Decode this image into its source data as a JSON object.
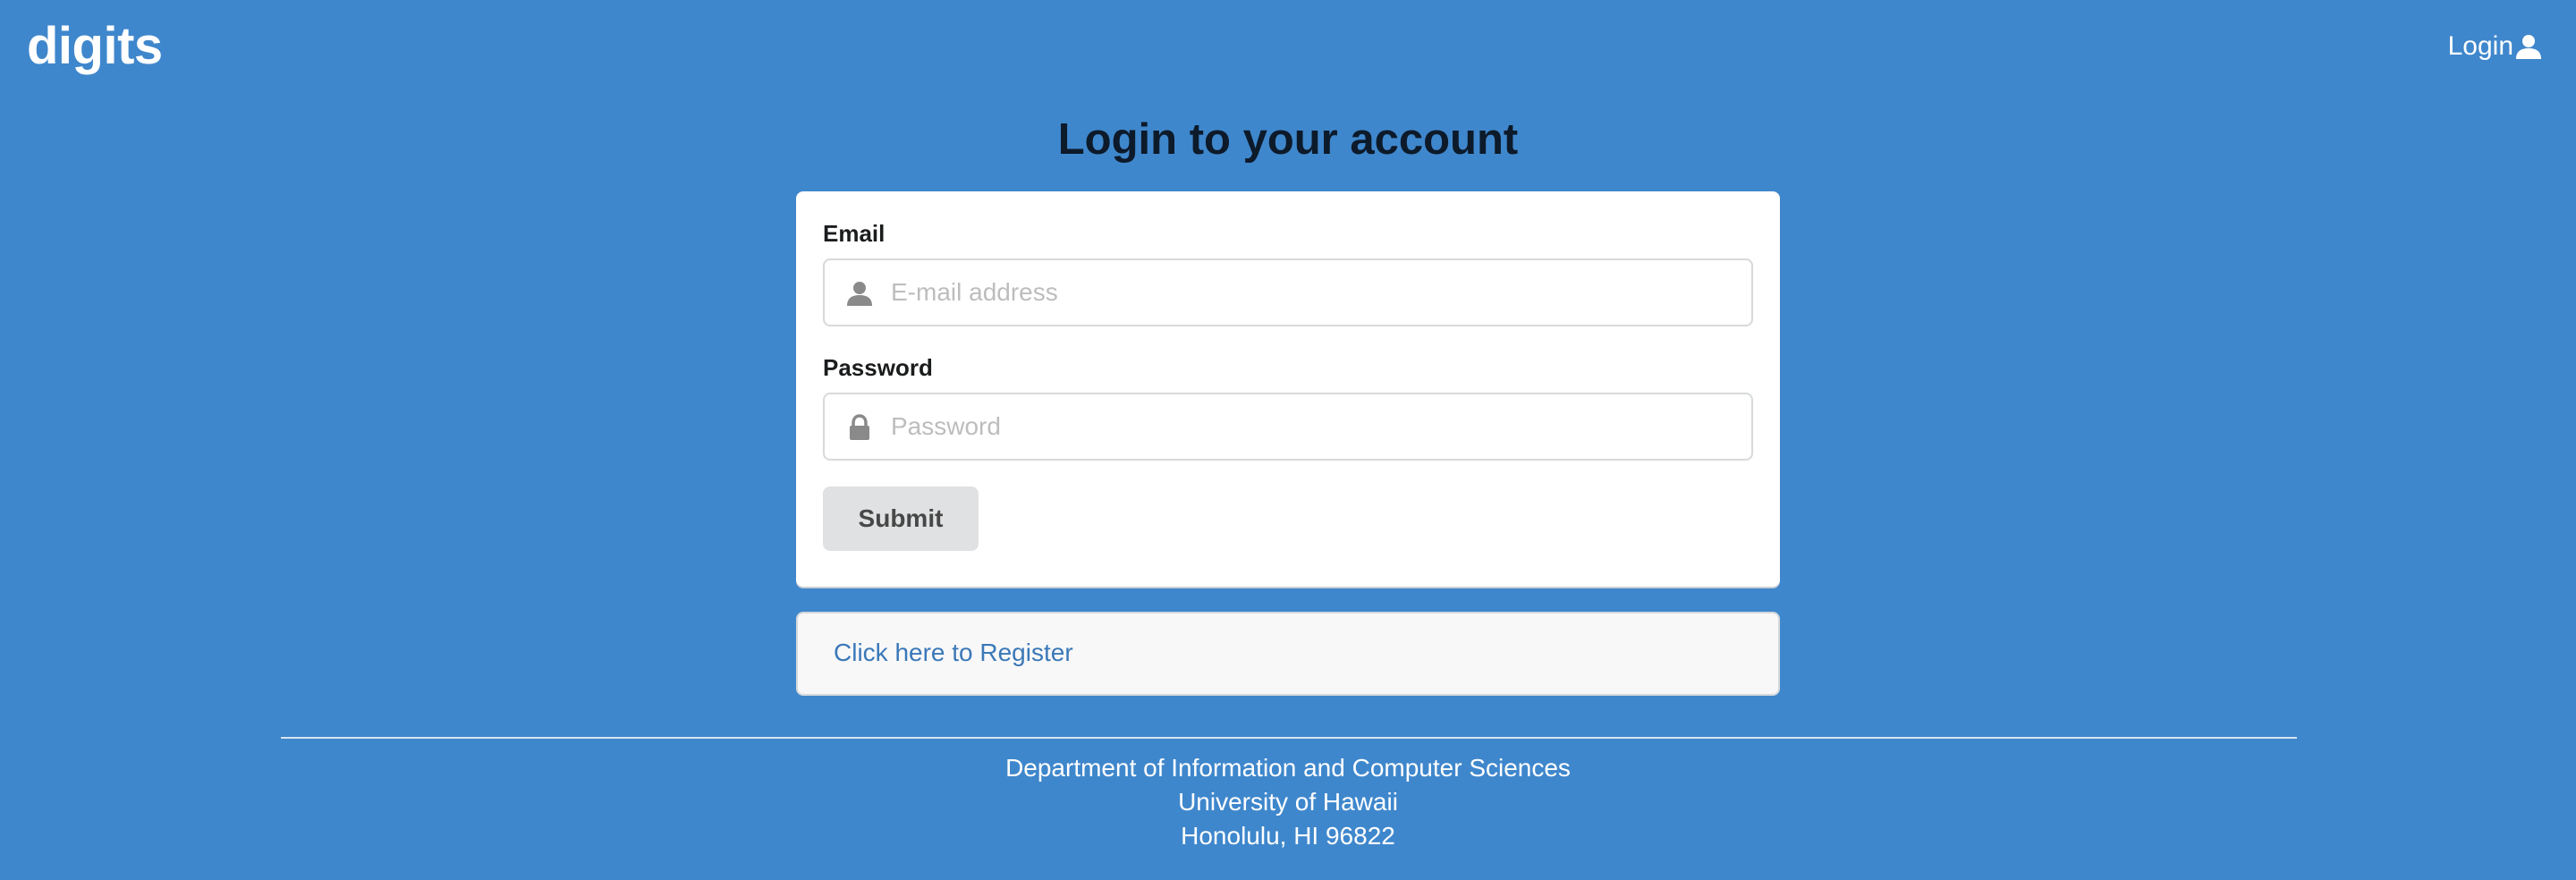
{
  "header": {
    "brand": "digits",
    "nav_login_label": "Login",
    "nav_login_icon": "user-icon"
  },
  "main": {
    "title": "Login to your account",
    "form": {
      "email_label": "Email",
      "email_placeholder": "E-mail address",
      "email_value": "",
      "email_icon": "user-icon",
      "password_label": "Password",
      "password_placeholder": "Password",
      "password_value": "",
      "password_icon": "lock-icon",
      "submit_label": "Submit"
    },
    "register_link": "Click here to Register"
  },
  "footer": {
    "lines": [
      "Department of Information and Computer Sciences",
      "University of Hawaii",
      "Honolulu, HI 96822"
    ]
  },
  "colors": {
    "page_background": "#3f87cc",
    "card_background": "#ffffff",
    "link": "#3a78b8",
    "button_background": "#e0e1e2",
    "icon_gray": "#8a8a8a"
  }
}
